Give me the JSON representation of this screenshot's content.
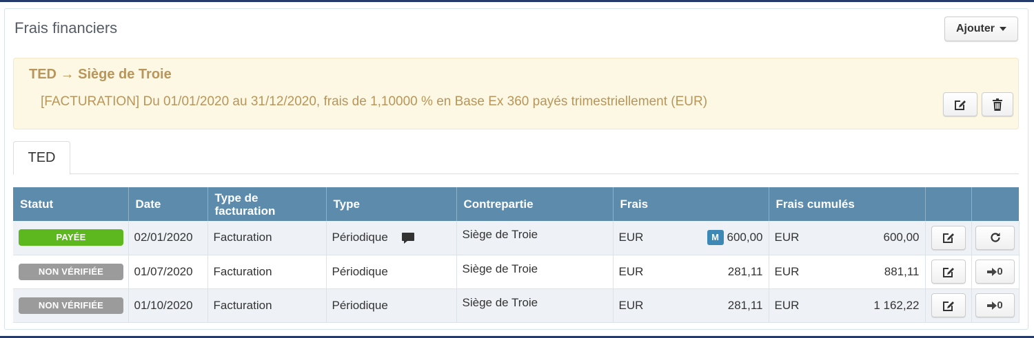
{
  "panel": {
    "title": "Frais financiers",
    "add_button": "Ajouter"
  },
  "alert": {
    "title": "TED → Siège de Troie",
    "text": "[FACTURATION] Du 01/01/2020 au 31/12/2020, frais de 1,10000 % en Base Ex 360 payés trimestriellement (EUR)",
    "edit_icon": "edit-icon",
    "delete_icon": "trash-icon"
  },
  "tabs": [
    {
      "label": "TED",
      "active": true
    }
  ],
  "table": {
    "headers": {
      "statut": "Statut",
      "date": "Date",
      "type_facturation": "Type de facturation",
      "type": "Type",
      "contrepartie": "Contrepartie",
      "frais": "Frais",
      "frais_cumules": "Frais cumulés"
    },
    "rows": [
      {
        "statut": "PAYÉE",
        "date": "02/01/2020",
        "type_facturation": "Facturation",
        "type": "Périodique",
        "contrepartie": "Siège de Troie",
        "frais_currency": "EUR",
        "frais_tag": "M",
        "frais_value": "600,00",
        "cumul_currency": "EUR",
        "cumul_value": "600,00",
        "action_label": ""
      },
      {
        "statut": "NON VÉRIFIÉE",
        "date": "01/07/2020",
        "type_facturation": "Facturation",
        "type": "Périodique",
        "contrepartie": "Siège de Troie",
        "frais_currency": "EUR",
        "frais_value": "281,11",
        "cumul_currency": "EUR",
        "cumul_value": "881,11",
        "action_label": "0"
      },
      {
        "statut": "NON VÉRIFIÉE",
        "date": "01/10/2020",
        "type_facturation": "Facturation",
        "type": "Périodique",
        "contrepartie": "Siège de Troie",
        "frais_currency": "EUR",
        "frais_value": "281,11",
        "cumul_currency": "EUR",
        "cumul_value": "1 162,22",
        "action_label": "0"
      }
    ]
  },
  "colors": {
    "header_bg": "#5d8bac",
    "alert_bg": "#fcf8e3",
    "alert_text": "#b8955a",
    "badge_paid": "#5cb81e",
    "badge_unverified": "#9b9b9b",
    "m_tag": "#3e88b5"
  }
}
